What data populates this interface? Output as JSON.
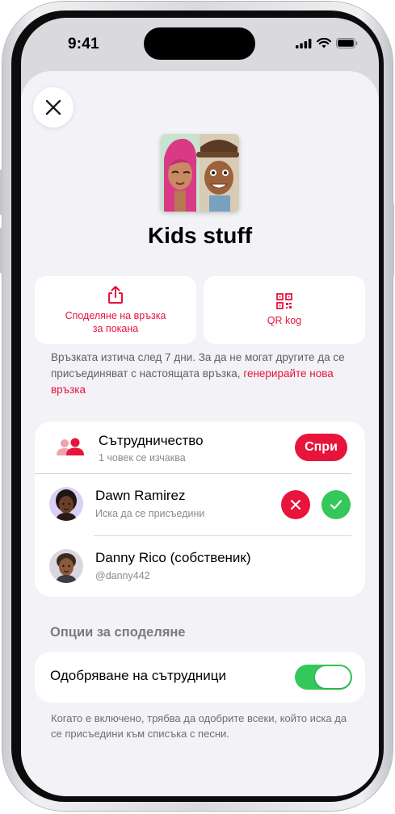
{
  "status_bar": {
    "time": "9:41"
  },
  "sheet": {
    "playlist_title": "Kids stuff",
    "actions": {
      "share_link": "Споделяне на връзка за покана",
      "qr_code": "QR kog"
    },
    "expiry_note": {
      "text": "Връзката изтича след 7 дни. За да не могат другите да се присъединяват с настоящата връзка, ",
      "link": "генерирайте нова връзка"
    },
    "collaboration": {
      "title": "Сътрудничество",
      "subtitle": "1 човек се изчаква",
      "stop_label": "Спри"
    },
    "people": [
      {
        "name": "Dawn Ramirez",
        "detail": "Иска да се присъедини"
      },
      {
        "name": "Danny Rico (собственик)",
        "detail": "@danny442"
      }
    ],
    "sharing_options": {
      "header": "Опции за споделяне",
      "approve_label": "Одобряване на сътрудници",
      "approve_on": true,
      "footnote": "Когато е включено, трябва да одобрите всеки, който иска да се присъедини към списъка с песни."
    }
  },
  "colors": {
    "accent": "#e8143c",
    "toggle_on": "#34c759",
    "sheet_bg": "#f2f2f7"
  }
}
